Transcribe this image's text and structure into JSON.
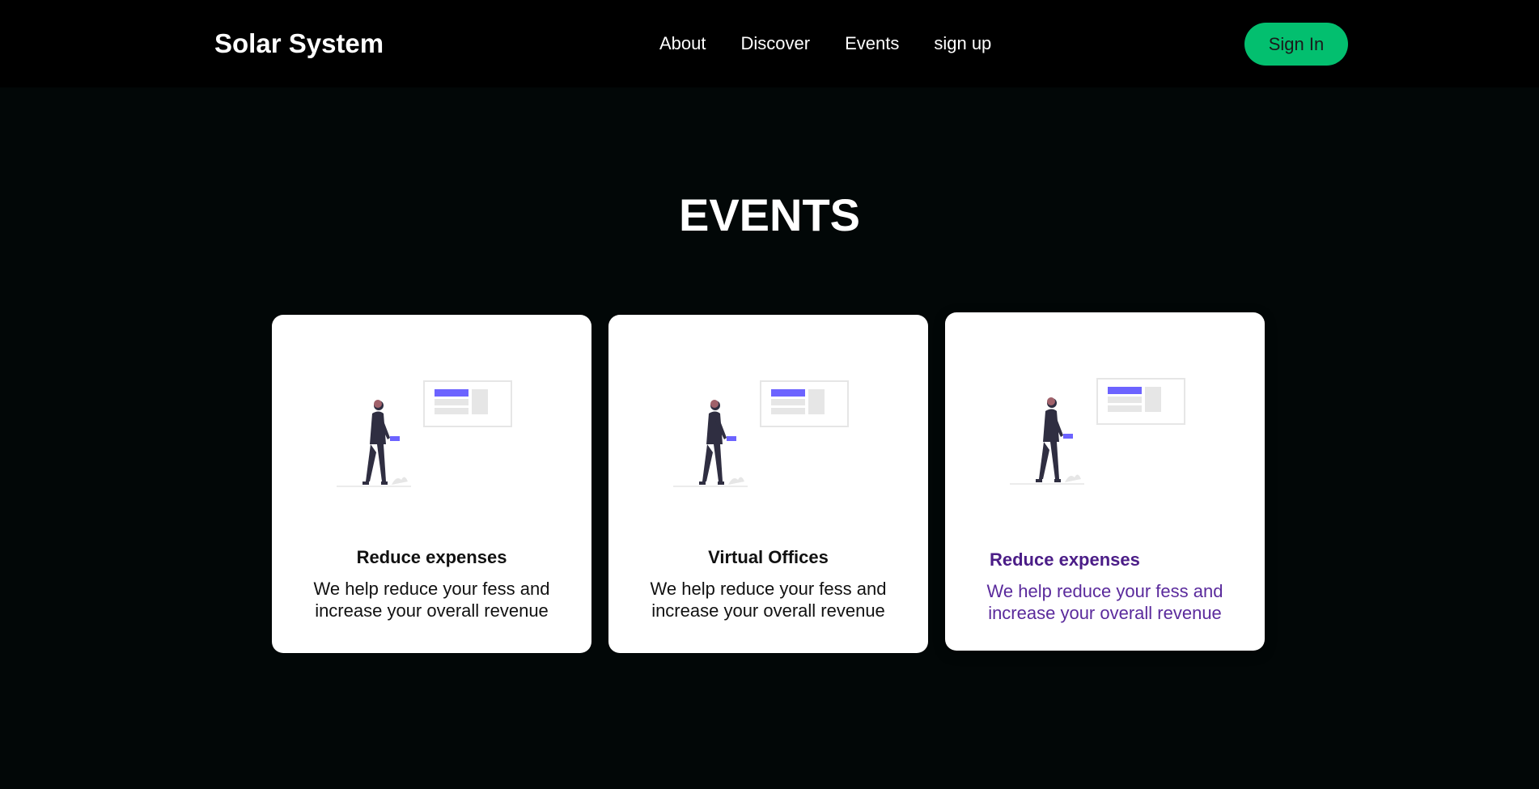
{
  "header": {
    "logo": "Solar System",
    "nav": [
      "About",
      "Discover",
      "Events",
      "sign up"
    ],
    "signin_label": "Sign In"
  },
  "events": {
    "title": "EVENTS",
    "cards": [
      {
        "title": "Reduce expenses",
        "text": "We help reduce your fess and increase your overall revenue"
      },
      {
        "title": "Virtual Offices",
        "text": "We help reduce your fess and increase your overall revenue"
      },
      {
        "title": "Reduce expenses",
        "text": "We help reduce your fess and increase your overall revenue"
      }
    ]
  },
  "colors": {
    "background": "#020707",
    "header": "#000000",
    "accent_green": "#03bf6f",
    "illustration_accent": "#6c63ff",
    "hover_purple": "#4b1d87"
  },
  "icons": [
    "person-presenting-illustration"
  ]
}
